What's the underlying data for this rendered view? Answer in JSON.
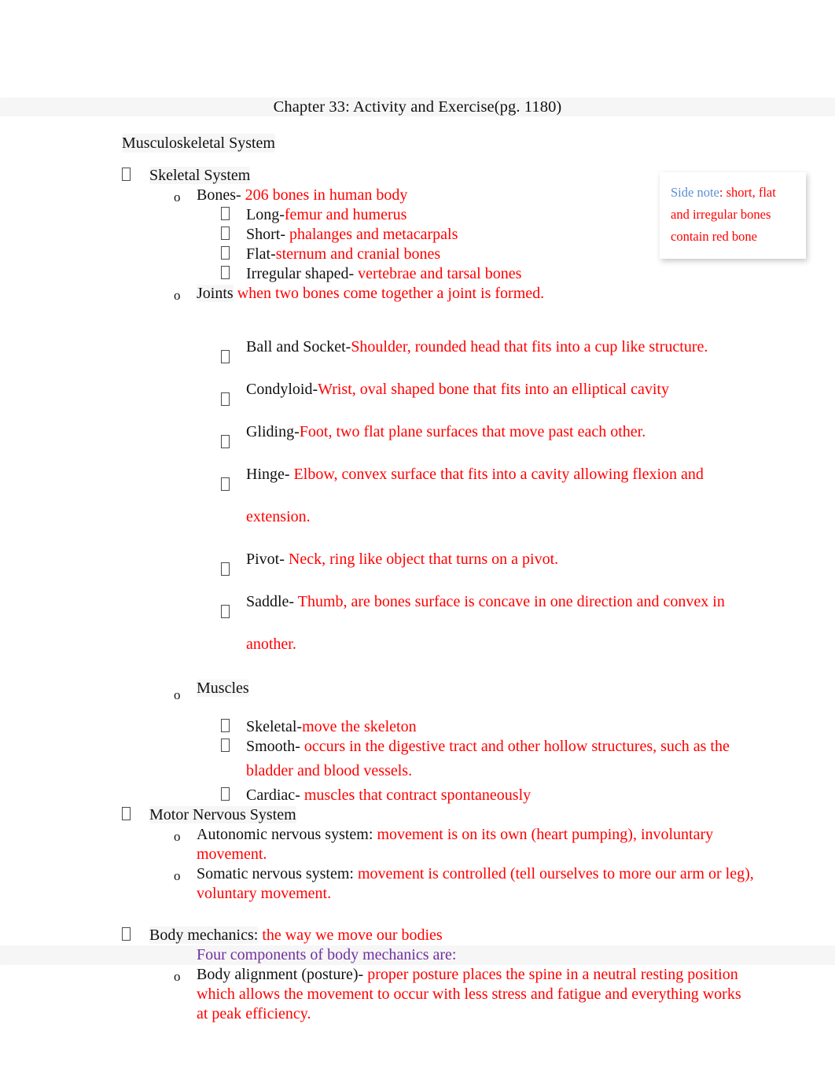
{
  "document": {
    "title": "Chapter 33: Activity and Exercise(pg. 1180)",
    "heading": "Musculoskeletal System"
  },
  "colors": {
    "body_text": "#111111",
    "accent_red": "#FF0000",
    "accent_purple": "#7030A0",
    "accent_blue": "#5B8FD6",
    "page_background": "#FFFFFF"
  },
  "sidenote": {
    "label": "Side note",
    "separator": ":",
    "body": " short, flat and irregular bones contain red bone"
  },
  "outline": {
    "skeletal_system": {
      "label": "Skeletal System",
      "bones": {
        "label": "Bones-",
        "value": " 206 bones in human body",
        "types": [
          {
            "label": "Long-",
            "value": "femur and humerus"
          },
          {
            "label": "Short-",
            "value": " phalanges and metacarpals"
          },
          {
            "label": "Flat-",
            "value": "sternum and cranial bones"
          },
          {
            "label": "Irregular shaped-",
            "value": " vertebrae and tarsal bones"
          }
        ]
      },
      "joints": {
        "label": "Joints",
        "value": " when two bones come together a joint is formed.",
        "types": [
          {
            "label": "Ball and Socket-",
            "value": "Shoulder, rounded head that fits into a cup like structure."
          },
          {
            "label": "Condyloid-",
            "value": "Wrist, oval shaped bone that fits into an elliptical cavity"
          },
          {
            "label": "Gliding-",
            "value": "Foot, two flat plane surfaces that move past each other."
          },
          {
            "label": "Hinge-",
            "value": " Elbow, convex surface that fits into a cavity allowing flexion and",
            "value_cont": "extension."
          },
          {
            "label": "Pivot-",
            "value": " Neck, ring like object that turns on a pivot."
          },
          {
            "label": "Saddle-",
            "value": " Thumb, are bones surface is concave in one direction and convex in",
            "value_cont": "another."
          }
        ]
      },
      "muscles": {
        "label": "Muscles",
        "types": [
          {
            "label": "Skeletal-",
            "value": "move the skeleton"
          },
          {
            "label": "Smooth-",
            "value": " occurs in the digestive tract and other hollow structures, such as the",
            "value_cont": "bladder and blood vessels."
          },
          {
            "label": "Cardiac-",
            "value": " muscles that contract spontaneously"
          }
        ]
      }
    },
    "motor_nervous_system": {
      "label": "Motor Nervous System",
      "items": [
        {
          "label": "Autonomic nervous system:",
          "value": " movement is on its own (heart pumping), involuntary",
          "value_cont": "movement."
        },
        {
          "label": "Somatic nervous system:",
          "value": " movement is controlled (tell ourselves to more our arm or leg),",
          "value_cont": "voluntary movement."
        }
      ]
    },
    "body_mechanics": {
      "label": "Body mechanics:",
      "value": " the way we move our bodies",
      "note": "Four components of body mechanics are:",
      "items": [
        {
          "label": "Body alignment (posture)-",
          "value": " proper posture places the spine in a neutral resting position",
          "value_cont": "which allows the movement to occur with less stress and fatigue and everything works",
          "value_cont2": "at peak efficiency."
        }
      ]
    }
  }
}
